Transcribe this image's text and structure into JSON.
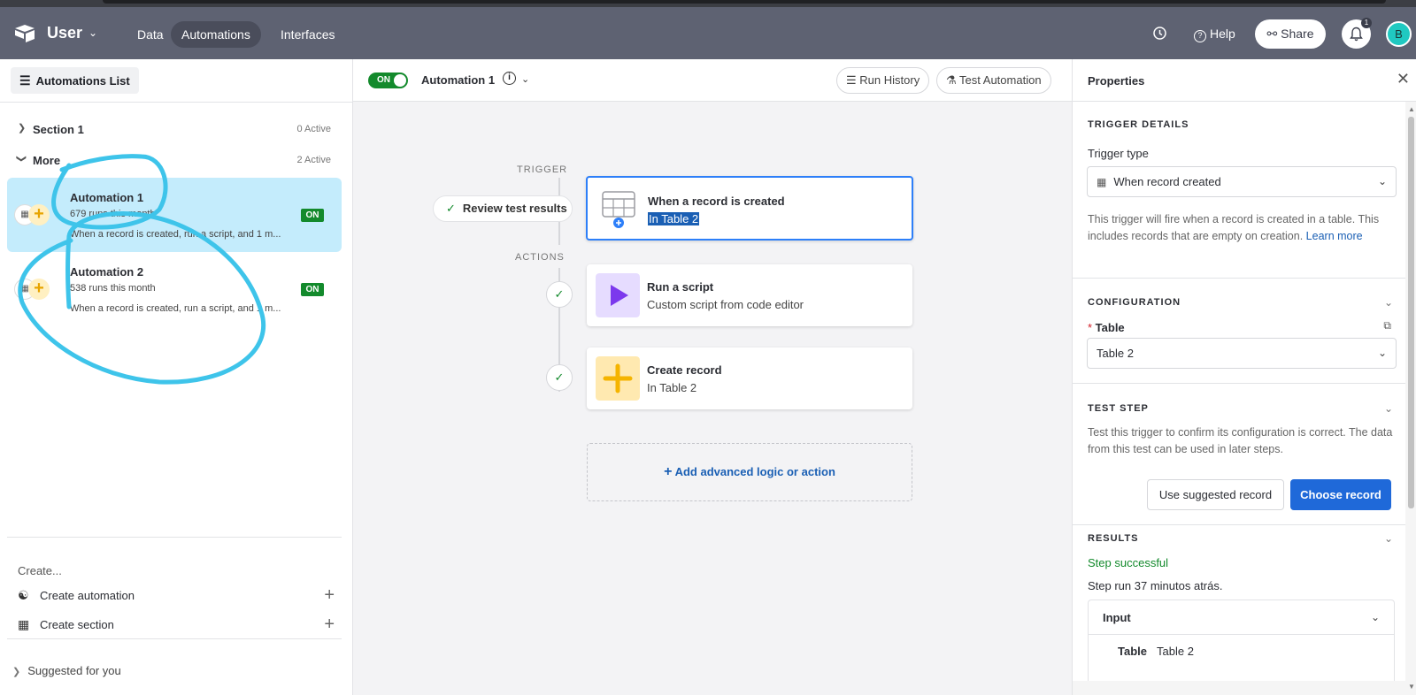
{
  "topbar": {
    "base_name": "User",
    "nav": [
      "Data",
      "Automations",
      "Interfaces"
    ],
    "help": "Help",
    "share": "Share",
    "notification_count": "1",
    "avatar_initial": "B"
  },
  "left": {
    "header": "Automations List",
    "sections": [
      {
        "label": "Section 1",
        "count": "0 Active"
      },
      {
        "label": "More",
        "count": "2 Active"
      }
    ],
    "automations": [
      {
        "name": "Automation 1",
        "runs": "679 runs this month",
        "desc": "When a record is created, run a script, and 1 m...",
        "status": "ON"
      },
      {
        "name": "Automation 2",
        "runs": "538 runs this month",
        "desc": "When a record is created, run a script, and 1 m...",
        "status": "ON"
      }
    ],
    "create_label": "Create...",
    "create_automation": "Create automation",
    "create_section": "Create section",
    "suggested": "Suggested for you"
  },
  "center": {
    "toggle": "ON",
    "title": "Automation 1",
    "run_history": "Run History",
    "test_automation": "Test Automation",
    "trigger_label": "TRIGGER",
    "actions_label": "ACTIONS",
    "review": "Review test results",
    "trigger": {
      "title": "When a record is created",
      "sub": "In Table 2"
    },
    "actions": [
      {
        "title": "Run a script",
        "sub": "Custom script from code editor"
      },
      {
        "title": "Create record",
        "sub": "In Table 2"
      }
    ],
    "add": "Add advanced logic or action"
  },
  "right": {
    "title": "Properties",
    "trigger_details": "TRIGGER DETAILS",
    "trigger_type_label": "Trigger type",
    "trigger_type_value": "When record created",
    "trigger_desc": "This trigger will fire when a record is created in a table. This includes records that are empty on creation.",
    "learn_more": "Learn more",
    "configuration": "CONFIGURATION",
    "table_label": "Table",
    "table_value": "Table 2",
    "test_step": "TEST STEP",
    "test_desc": "Test this trigger to confirm its configuration is correct. The data from this test can be used in later steps.",
    "use_suggested": "Use suggested record",
    "choose_record": "Choose record",
    "results": "RESULTS",
    "step_success": "Step successful",
    "step_run": "Step run 37 minutos atrás.",
    "input_title": "Input",
    "input_key": "Table",
    "input_value": "Table 2"
  }
}
